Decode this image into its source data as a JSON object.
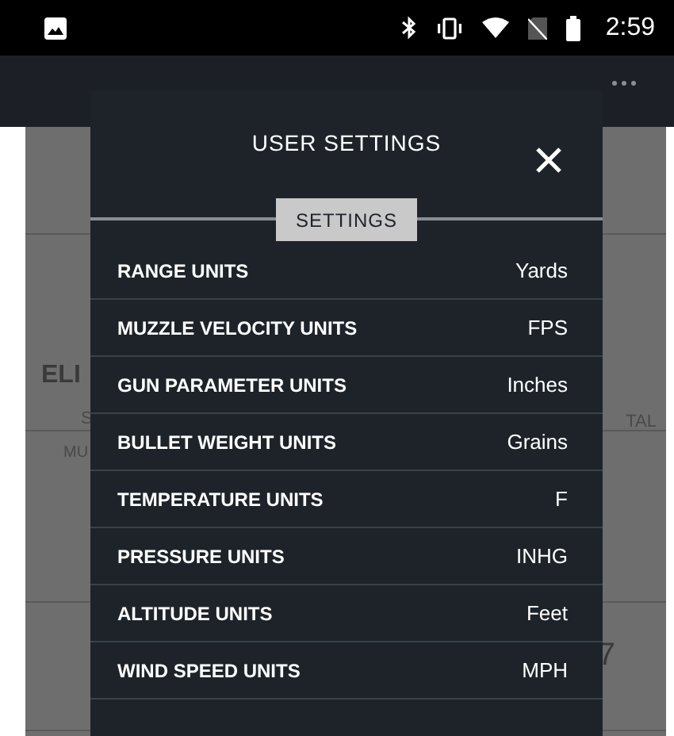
{
  "status_bar": {
    "time": "2:59"
  },
  "background": {
    "texts": [
      {
        "kind": "heading",
        "text": "ELI"
      },
      {
        "kind": "left",
        "text": "S"
      },
      {
        "kind": "right",
        "text": "TAL"
      },
      {
        "kind": "small",
        "text": "MU"
      },
      {
        "kind": "big",
        "text": "7"
      }
    ]
  },
  "dialog": {
    "title": "USER SETTINGS",
    "section": "SETTINGS",
    "rows": [
      {
        "label": "RANGE UNITS",
        "value": "Yards"
      },
      {
        "label": "MUZZLE VELOCITY UNITS",
        "value": "FPS"
      },
      {
        "label": "GUN PARAMETER UNITS",
        "value": "Inches"
      },
      {
        "label": "BULLET WEIGHT UNITS",
        "value": "Grains"
      },
      {
        "label": "TEMPERATURE UNITS",
        "value": "F"
      },
      {
        "label": "PRESSURE UNITS",
        "value": "INHG"
      },
      {
        "label": "ALTITUDE UNITS",
        "value": "Feet"
      },
      {
        "label": "WIND SPEED UNITS",
        "value": "MPH"
      }
    ]
  }
}
